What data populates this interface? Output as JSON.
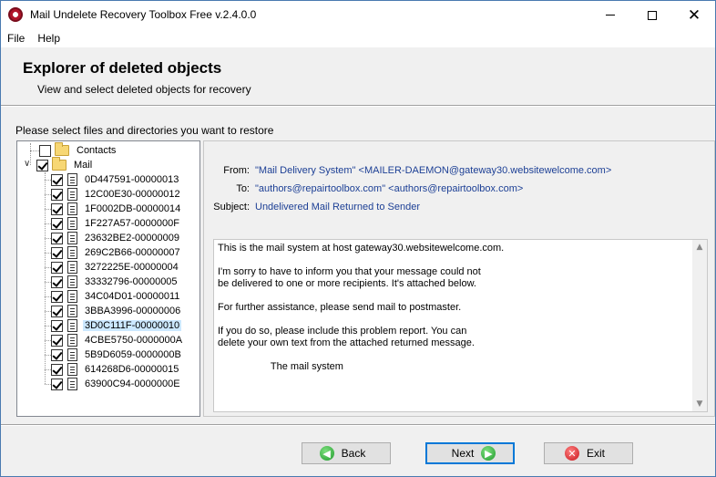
{
  "window": {
    "title": "Mail Undelete Recovery Toolbox Free v.2.4.0.0"
  },
  "menu": [
    "File",
    "Help"
  ],
  "header": {
    "title": "Explorer of deleted objects",
    "subtitle": "View and select deleted objects for recovery"
  },
  "instruction": "Please select files and directories you want to restore",
  "tree": {
    "folders": [
      {
        "label": "Contacts",
        "checked": false,
        "expanded": false
      },
      {
        "label": "Mail",
        "checked": true,
        "expanded": true
      }
    ],
    "items": [
      {
        "label": "0D447591-00000013",
        "checked": true,
        "selected": false
      },
      {
        "label": "12C00E30-00000012",
        "checked": true,
        "selected": false
      },
      {
        "label": "1F0002DB-00000014",
        "checked": true,
        "selected": false
      },
      {
        "label": "1F227A57-0000000F",
        "checked": true,
        "selected": false
      },
      {
        "label": "23632BE2-00000009",
        "checked": true,
        "selected": false
      },
      {
        "label": "269C2B66-00000007",
        "checked": true,
        "selected": false
      },
      {
        "label": "3272225E-00000004",
        "checked": true,
        "selected": false
      },
      {
        "label": "33332796-00000005",
        "checked": true,
        "selected": false
      },
      {
        "label": "34C04D01-00000011",
        "checked": true,
        "selected": false
      },
      {
        "label": "3BBA3996-00000006",
        "checked": true,
        "selected": false
      },
      {
        "label": "3D0C111F-00000010",
        "checked": true,
        "selected": true
      },
      {
        "label": "4CBE5750-0000000A",
        "checked": true,
        "selected": false
      },
      {
        "label": "5B9D6059-0000000B",
        "checked": true,
        "selected": false
      },
      {
        "label": "614268D6-00000015",
        "checked": true,
        "selected": false
      },
      {
        "label": "63900C94-0000000E",
        "checked": true,
        "selected": false
      }
    ]
  },
  "message": {
    "from_label": "From:",
    "from_value": "\"Mail Delivery System\" <MAILER-DAEMON@gateway30.websitewelcome.com>",
    "to_label": "To:",
    "to_value": "\"authors@repairtoolbox.com\" <authors@repairtoolbox.com>",
    "subject_label": "Subject:",
    "subject_value": "Undelivered Mail Returned to Sender",
    "body": "This is the mail system at host gateway30.websitewelcome.com.\n\nI'm sorry to have to inform you that your message could not\nbe delivered to one or more recipients. It's attached below.\n\nFor further assistance, please send mail to postmaster.\n\nIf you do so, please include this problem report. You can\ndelete your own text from the attached returned message.\n\n                   The mail system"
  },
  "buttons": {
    "back": "Back",
    "next": "Next",
    "exit": "Exit"
  },
  "colors": {
    "link_blue": "#1c3f95",
    "selection": "#cce8ff",
    "default_button_border": "#0078d7"
  }
}
